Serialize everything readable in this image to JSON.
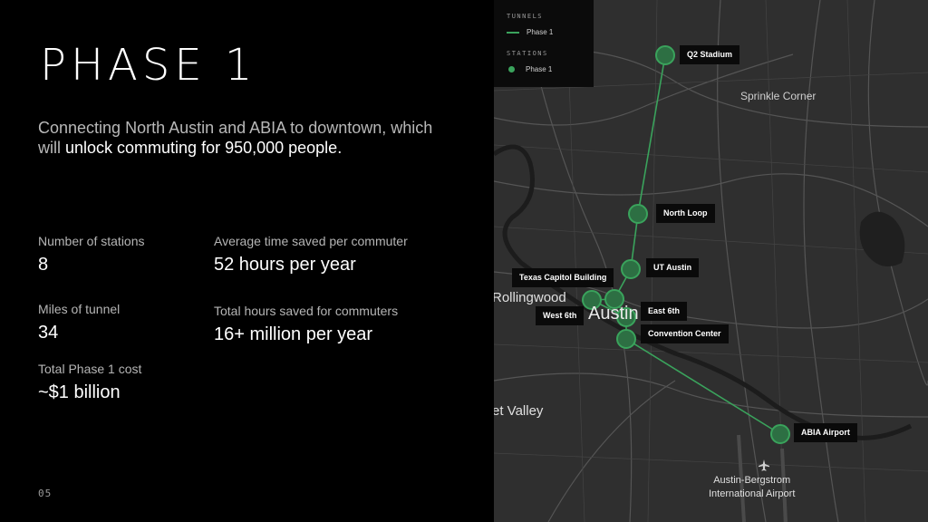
{
  "title": "PHASE 1",
  "intro": {
    "part1": "Connecting North Austin and ABIA to downtown, which will ",
    "highlight": "unlock commuting for 950,000 people."
  },
  "stats": {
    "stations": {
      "label": "Number of stations",
      "value": "8"
    },
    "miles": {
      "label": "Miles of tunnel",
      "value": "34"
    },
    "cost": {
      "label": "Total Phase 1 cost",
      "value": "~$1 billion"
    },
    "time_saved": {
      "label": "Average time saved per commuter",
      "value": "52 hours per year"
    },
    "hours_saved": {
      "label": "Total hours saved for commuters",
      "value": "16+ million per year"
    }
  },
  "page_number": "05",
  "legend": {
    "tunnels_header": "TUNNELS",
    "tunnel_item": "Phase 1",
    "stations_header": "STATIONS",
    "station_item": "Phase 1"
  },
  "colors": {
    "route": "#3aa35c",
    "map_background": "#2f2f2f",
    "panel_background": "#000000"
  },
  "map_labels": {
    "sprinkle_corner": "Sprinkle Corner",
    "rollingwood": "Rollingwood",
    "austin": "Austin",
    "valley": "et Valley",
    "airport": "Austin-Bergstrom International Airport",
    "airport_line1": "Austin-Bergstrom",
    "airport_line2": "International Airport",
    "airport_icon": "airplane-icon"
  },
  "stations": {
    "q2": "Q2 Stadium",
    "north_loop": "North Loop",
    "ut_austin": "UT Austin",
    "texas_capitol": "Texas Capitol Building",
    "west_6th": "West 6th",
    "east_6th": "East 6th",
    "convention_center": "Convention Center",
    "abia": "ABIA Airport"
  }
}
